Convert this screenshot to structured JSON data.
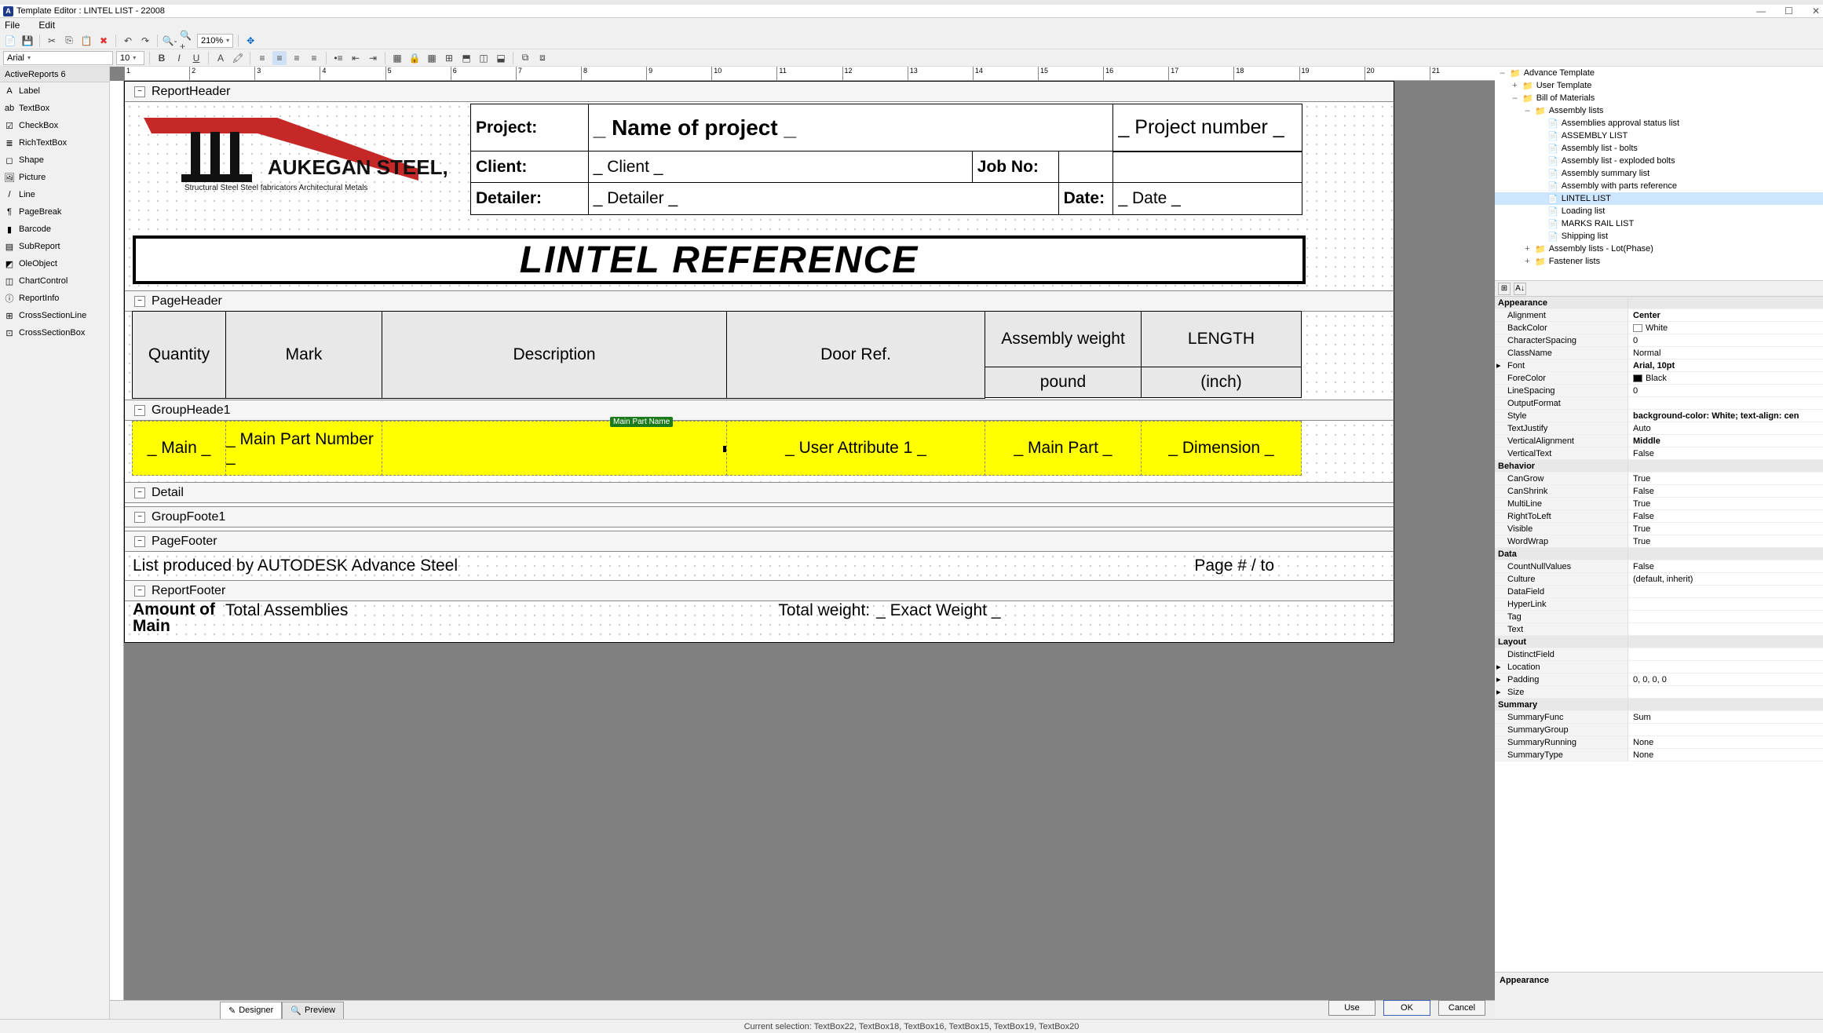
{
  "window": {
    "title": "Template Editor : LINTEL LIST - 22008"
  },
  "menus": [
    "File",
    "Edit"
  ],
  "toolbar1": {
    "zoom": "210%"
  },
  "toolbar2": {
    "font": "Arial",
    "size": "10"
  },
  "toolbox_group": "ActiveReports 6",
  "toolbox": [
    {
      "icon": "A",
      "name": "Label"
    },
    {
      "icon": "ab",
      "name": "TextBox"
    },
    {
      "icon": "☑",
      "name": "CheckBox"
    },
    {
      "icon": "≣",
      "name": "RichTextBox"
    },
    {
      "icon": "◻",
      "name": "Shape"
    },
    {
      "icon": "🖼",
      "name": "Picture"
    },
    {
      "icon": "/",
      "name": "Line"
    },
    {
      "icon": "¶",
      "name": "PageBreak"
    },
    {
      "icon": "▮",
      "name": "Barcode"
    },
    {
      "icon": "▤",
      "name": "SubReport"
    },
    {
      "icon": "◩",
      "name": "OleObject"
    },
    {
      "icon": "◫",
      "name": "ChartControl"
    },
    {
      "icon": "ⓘ",
      "name": "ReportInfo"
    },
    {
      "icon": "⊞",
      "name": "CrossSectionLine"
    },
    {
      "icon": "⊡",
      "name": "CrossSectionBox"
    }
  ],
  "ruler_ticks": [
    "1",
    "2",
    "3",
    "4",
    "5",
    "6",
    "7",
    "8",
    "9",
    "10",
    "11",
    "12",
    "13",
    "14",
    "15",
    "16",
    "17",
    "18",
    "19",
    "20",
    "21"
  ],
  "bands": {
    "reportHeader": "ReportHeader",
    "pageHeader": "PageHeader",
    "groupHeader": "GroupHeade1",
    "detail": "Detail",
    "groupFooter": "GroupFoote1",
    "pageFooter": "PageFooter",
    "reportFooter": "ReportFooter"
  },
  "hdr": {
    "logo_line1": "AUKEGAN STEEL, LLC",
    "logo_line2": "Structural Steel    Steel fabricators    Architectural Metals",
    "projLbl": "Project:",
    "projVal": "_ Name of project _",
    "cliLbl": "Client:",
    "cliVal": "_ Client _",
    "detLbl": "Detailer:",
    "detVal": "_ Detailer _",
    "jobLbl": "Job No:",
    "dateLbl": "Date:",
    "dateVal": "_ Date _",
    "pnVal": "_ Project number _",
    "title": "LINTEL REFERENCE"
  },
  "cols": {
    "qty": "Quantity",
    "mark": "Mark",
    "desc": "Description",
    "door": "Door Ref.",
    "asm1": "Assembly weight",
    "asm2": "pound",
    "len1": "LENGTH",
    "len2": "(inch)"
  },
  "group": {
    "c1": "_ Main _",
    "c2": "_ Main Part Number _",
    "tag": "Main Part Name",
    "c4": "_ User Attribute 1 _",
    "c5": "_ Main Part _",
    "c6": "_ Dimension _"
  },
  "pagefooter": {
    "left": "List produced by AUTODESK Advance Steel",
    "right": "Page   #  /   to"
  },
  "reportfooter": {
    "a": "Amount of Main",
    "b": "Total Assemblies",
    "c": "Total weight:",
    "d": "_ Exact Weight _"
  },
  "tabs": {
    "designer": "Designer",
    "preview": "Preview"
  },
  "dlgbtns": {
    "use": "Use",
    "ok": "OK",
    "cancel": "Cancel"
  },
  "tree": [
    {
      "d": 0,
      "t": "fld",
      "tw": "–",
      "label": "Advance Template"
    },
    {
      "d": 1,
      "t": "fld",
      "tw": "+",
      "label": "User Template"
    },
    {
      "d": 1,
      "t": "fld",
      "tw": "–",
      "label": "Bill of Materials"
    },
    {
      "d": 2,
      "t": "fld",
      "tw": "–",
      "label": "Assembly lists"
    },
    {
      "d": 3,
      "t": "doc",
      "label": "Assemblies approval status list"
    },
    {
      "d": 3,
      "t": "doc",
      "label": "ASSEMBLY LIST"
    },
    {
      "d": 3,
      "t": "doc",
      "label": "Assembly list - bolts"
    },
    {
      "d": 3,
      "t": "doc",
      "label": "Assembly list - exploded bolts"
    },
    {
      "d": 3,
      "t": "doc",
      "label": "Assembly summary list"
    },
    {
      "d": 3,
      "t": "doc",
      "label": "Assembly with parts reference"
    },
    {
      "d": 3,
      "t": "doc",
      "sel": true,
      "label": "LINTEL LIST"
    },
    {
      "d": 3,
      "t": "doc",
      "label": "Loading list"
    },
    {
      "d": 3,
      "t": "doc",
      "label": "MARKS RAIL LIST"
    },
    {
      "d": 3,
      "t": "doc",
      "label": "Shipping list"
    },
    {
      "d": 2,
      "t": "fld",
      "tw": "+",
      "label": "Assembly lists - Lot(Phase)"
    },
    {
      "d": 2,
      "t": "fld",
      "tw": "+",
      "label": "Fastener lists"
    }
  ],
  "props": [
    {
      "cat": true,
      "k": "Appearance"
    },
    {
      "k": "Alignment",
      "v": "Center",
      "b": true
    },
    {
      "k": "BackColor",
      "v": "White",
      "sw": "#ffffff"
    },
    {
      "k": "CharacterSpacing",
      "v": "0"
    },
    {
      "k": "ClassName",
      "v": "Normal"
    },
    {
      "k": "Font",
      "v": "Arial, 10pt",
      "b": true,
      "exp": true
    },
    {
      "k": "ForeColor",
      "v": "Black",
      "sw": "#000000"
    },
    {
      "k": "LineSpacing",
      "v": "0"
    },
    {
      "k": "OutputFormat",
      "v": ""
    },
    {
      "k": "Style",
      "v": "background-color: White; text-align: cen",
      "b": true
    },
    {
      "k": "TextJustify",
      "v": "Auto"
    },
    {
      "k": "VerticalAlignment",
      "v": "Middle",
      "b": true
    },
    {
      "k": "VerticalText",
      "v": "False"
    },
    {
      "cat": true,
      "k": "Behavior"
    },
    {
      "k": "CanGrow",
      "v": "True"
    },
    {
      "k": "CanShrink",
      "v": "False"
    },
    {
      "k": "MultiLine",
      "v": "True"
    },
    {
      "k": "RightToLeft",
      "v": "False"
    },
    {
      "k": "Visible",
      "v": "True"
    },
    {
      "k": "WordWrap",
      "v": "True"
    },
    {
      "cat": true,
      "k": "Data"
    },
    {
      "k": "CountNullValues",
      "v": "False"
    },
    {
      "k": "Culture",
      "v": "(default, inherit)"
    },
    {
      "k": "DataField",
      "v": ""
    },
    {
      "k": "HyperLink",
      "v": ""
    },
    {
      "k": "Tag",
      "v": ""
    },
    {
      "k": "Text",
      "v": ""
    },
    {
      "cat": true,
      "k": "Layout"
    },
    {
      "k": "DistinctField",
      "v": ""
    },
    {
      "k": "Location",
      "v": "",
      "exp": true
    },
    {
      "k": "Padding",
      "v": "0, 0, 0, 0",
      "exp": true
    },
    {
      "k": "Size",
      "v": "",
      "exp": true
    },
    {
      "cat": true,
      "k": "Summary"
    },
    {
      "k": "SummaryFunc",
      "v": "Sum"
    },
    {
      "k": "SummaryGroup",
      "v": ""
    },
    {
      "k": "SummaryRunning",
      "v": "None"
    },
    {
      "k": "SummaryType",
      "v": "None"
    }
  ],
  "propdesc": "Appearance",
  "status": "Current selection: TextBox22, TextBox18, TextBox16, TextBox15, TextBox19, TextBox20"
}
